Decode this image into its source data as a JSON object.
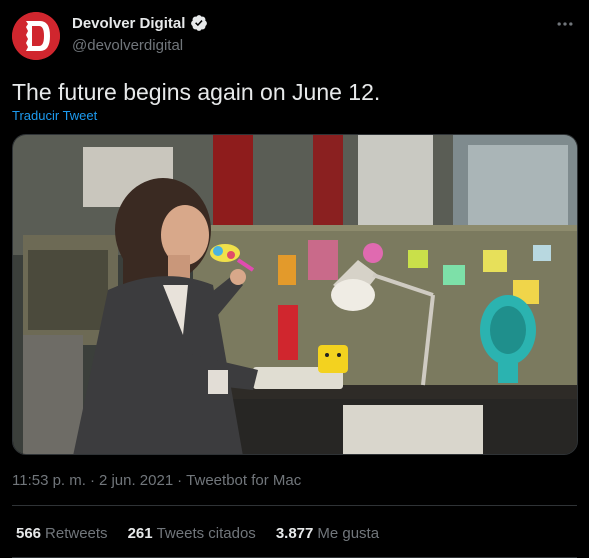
{
  "author": {
    "display_name": "Devolver Digital",
    "handle": "@devolverdigital",
    "avatar_letter": "D",
    "avatar_color": "#d0262e"
  },
  "tweet": {
    "text": "The future begins again on June 12.",
    "translate_label": "Traducir Tweet",
    "time": "11:53 p. m.",
    "separator": "·",
    "date": "2 jun. 2021",
    "source": "Tweetbot for Mac"
  },
  "stats": {
    "retweets_count": "566",
    "retweets_label": "Retweets",
    "quotes_count": "261",
    "quotes_label": "Tweets citados",
    "likes_count": "3.877",
    "likes_label": "Me gusta"
  },
  "colors": {
    "background": "#000000",
    "text": "#e7e9ea",
    "muted": "#71767b",
    "accent": "#1d9bf0",
    "border": "#2f3336"
  },
  "icons": [
    "devolver-logo-icon",
    "verified-badge-icon",
    "more-options-icon"
  ]
}
